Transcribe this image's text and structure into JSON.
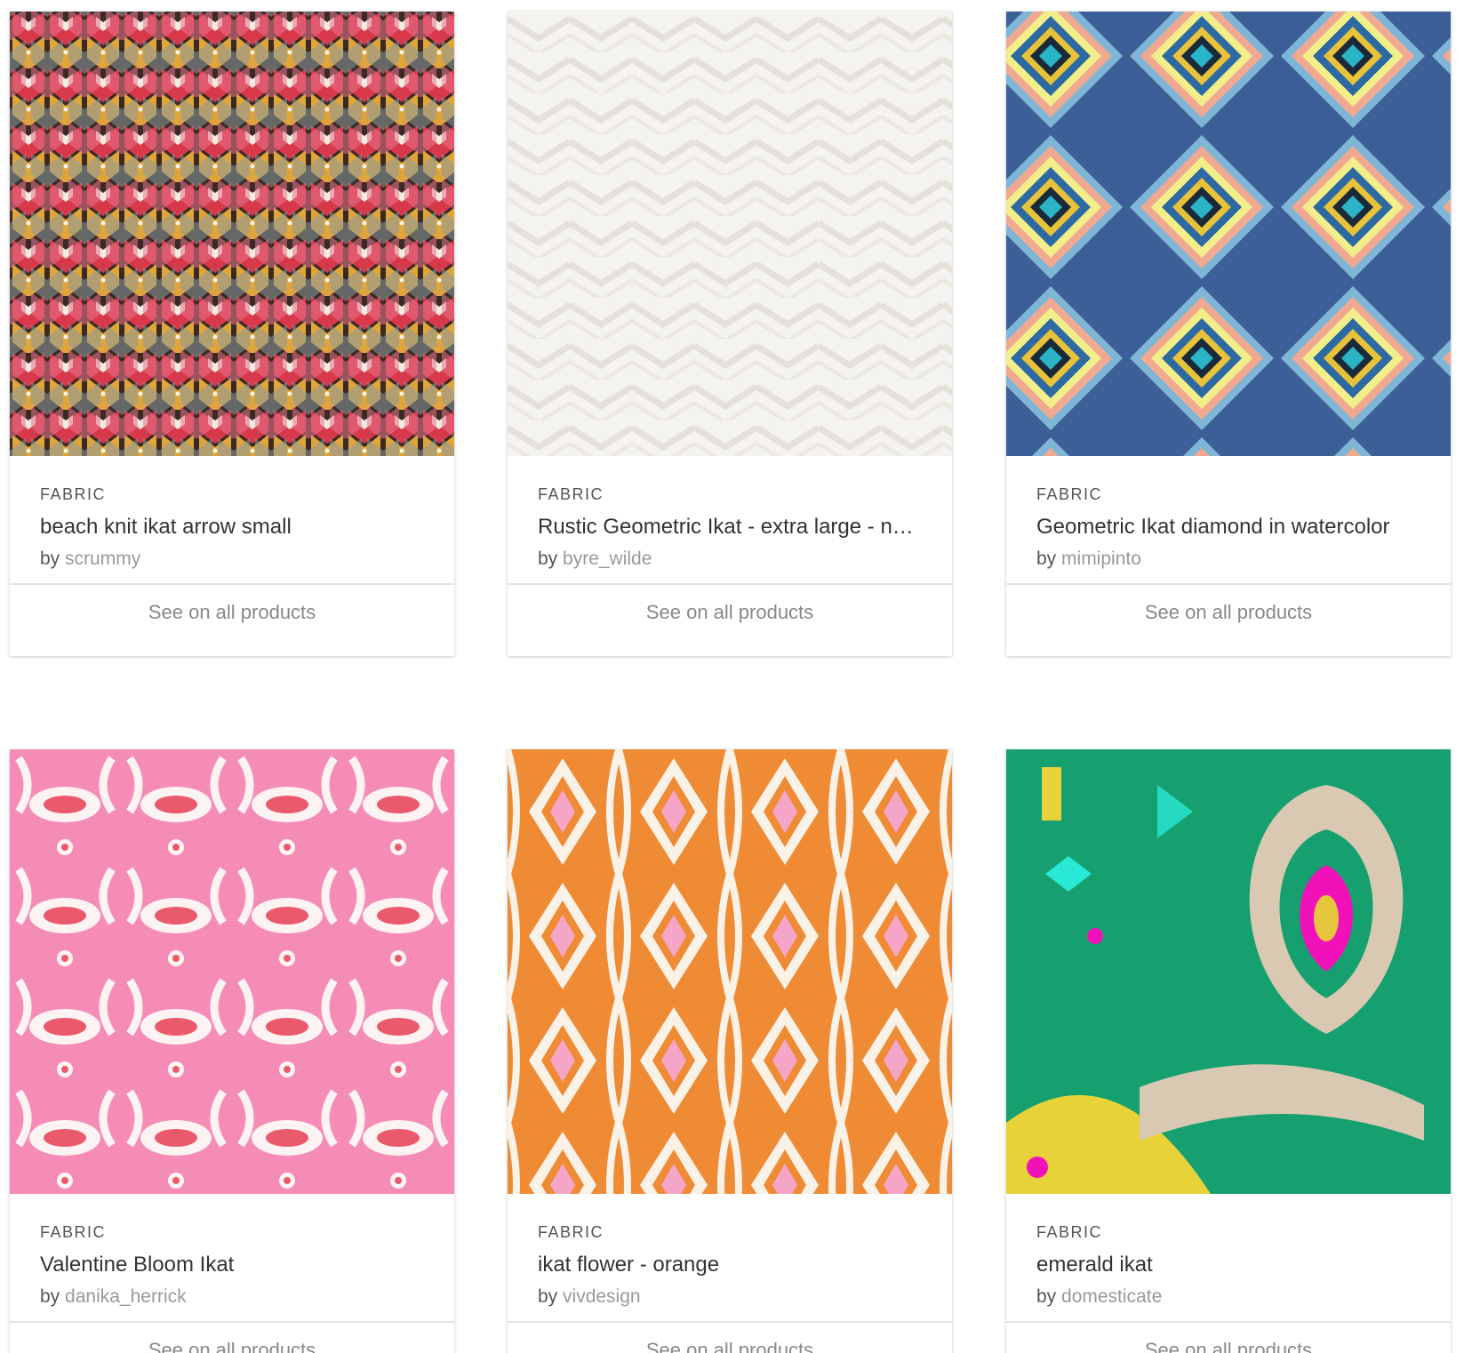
{
  "cards": [
    {
      "type": "FABRIC",
      "title": "beach knit ikat arrow small",
      "by": "by",
      "designer": "scrummy",
      "cta": "See on all products"
    },
    {
      "type": "FABRIC",
      "title": "Rustic Geometric Ikat - extra large - ne...",
      "by": "by",
      "designer": "byre_wilde",
      "cta": "See on all products"
    },
    {
      "type": "FABRIC",
      "title": "Geometric Ikat diamond in watercolor",
      "by": "by",
      "designer": "mimipinto",
      "cta": "See on all products"
    },
    {
      "type": "FABRIC",
      "title": "Valentine Bloom Ikat",
      "by": "by",
      "designer": "danika_herrick",
      "cta": "See on all products"
    },
    {
      "type": "FABRIC",
      "title": "ikat flower - orange",
      "by": "by",
      "designer": "vivdesign",
      "cta": "See on all products"
    },
    {
      "type": "FABRIC",
      "title": "emerald ikat",
      "by": "by",
      "designer": "domesticate",
      "cta": "See on all products"
    }
  ],
  "colors": {
    "page_bg": "#ffffff",
    "title_text": "#333333",
    "designer_link": "#999999",
    "cta_text": "#888888",
    "divider": "#e4e4e4"
  }
}
